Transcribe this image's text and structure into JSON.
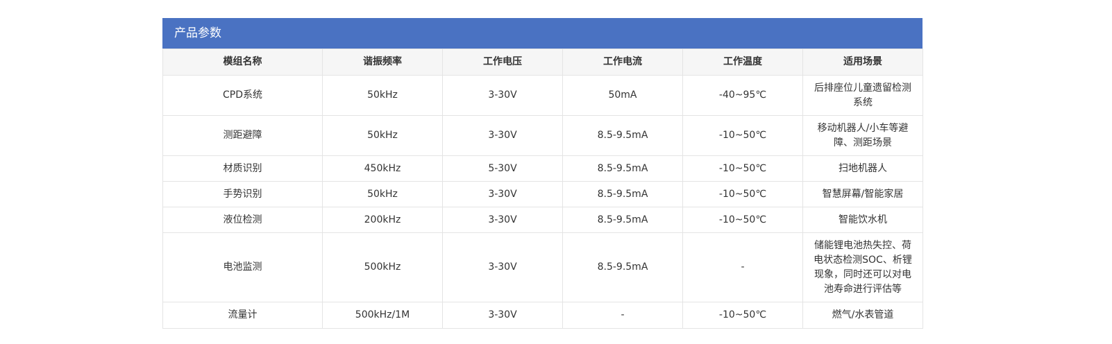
{
  "panel": {
    "title": "产品参数"
  },
  "table": {
    "headers": [
      "模组名称",
      "谐振频率",
      "工作电压",
      "工作电流",
      "工作温度",
      "适用场景"
    ],
    "rows": [
      {
        "name": "CPD系统",
        "freq": "50kHz",
        "voltage": "3-30V",
        "current": "50mA",
        "temp": "-40~95℃",
        "scene": [
          "后排座位儿童遗留检测",
          "系统"
        ]
      },
      {
        "name": "测距避障",
        "freq": "50kHz",
        "voltage": "3-30V",
        "current": "8.5-9.5mA",
        "temp": "-10~50℃",
        "scene": [
          "移动机器人/小车等避",
          "障、测距场景"
        ]
      },
      {
        "name": "材质识别",
        "freq": "450kHz",
        "voltage": "5-30V",
        "current": "8.5-9.5mA",
        "temp": "-10~50℃",
        "scene": [
          "扫地机器人"
        ]
      },
      {
        "name": "手势识别",
        "freq": "50kHz",
        "voltage": "3-30V",
        "current": "8.5-9.5mA",
        "temp": "-10~50℃",
        "scene": [
          "智慧屏幕/智能家居"
        ]
      },
      {
        "name": "液位检测",
        "freq": "200kHz",
        "voltage": "3-30V",
        "current": "8.5-9.5mA",
        "temp": "-10~50℃",
        "scene": [
          "智能饮水机"
        ]
      },
      {
        "name": "电池监测",
        "freq": "500kHz",
        "voltage": "3-30V",
        "current": "8.5-9.5mA",
        "temp": "-",
        "scene": [
          "储能锂电池热失控、荷",
          "电状态检测SOC、析锂",
          "现象，同时还可以对电",
          "池寿命进行评估等"
        ]
      },
      {
        "name": "流量计",
        "freq": "500kHz/1M",
        "voltage": "3-30V",
        "current": "-",
        "temp": "-10~50℃",
        "scene": [
          "燃气/水表管道"
        ]
      }
    ]
  },
  "colors": {
    "header_bg": "#4a72c2",
    "thead_bg": "#f6f6f6",
    "border": "#e4e4e4"
  }
}
